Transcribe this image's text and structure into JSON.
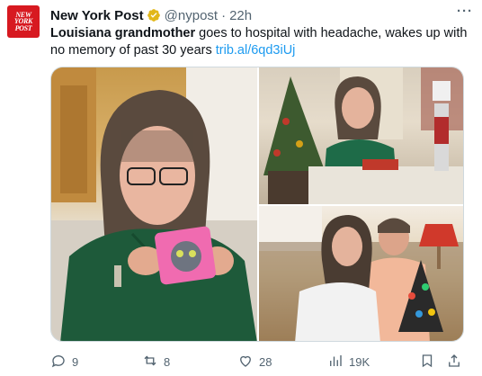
{
  "post": {
    "avatar_lines": [
      "NEW",
      "YORK",
      "POST"
    ],
    "author": "New York Post",
    "handle": "@nypost",
    "separator": "·",
    "time": "22h",
    "more": "···",
    "text_bold": "Louisiana grandmother",
    "text_rest": " goes to hospital with headache, wakes up with no memory of past 30 years ",
    "link": "trib.al/6qd3iUj"
  },
  "media": {
    "photos": [
      "woman-holding-cat-sticker",
      "woman-at-table-with-christmas-tree",
      "couple-on-couch-with-toy"
    ]
  },
  "actions": {
    "replies": "9",
    "reposts": "8",
    "likes": "28",
    "views": "19K"
  },
  "colors": {
    "brand": "#d71920",
    "link": "#1d9bf0",
    "muted": "#536471",
    "verified": "#e2b719"
  }
}
